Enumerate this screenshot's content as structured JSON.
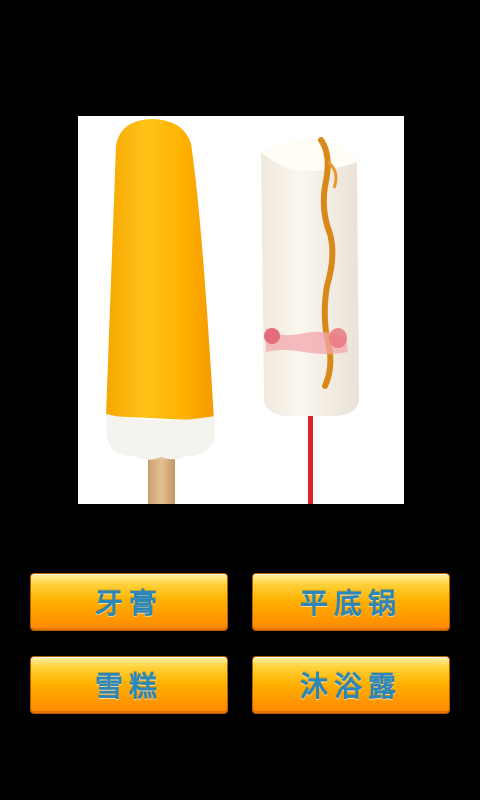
{
  "question": {
    "image": "ice-pops-photo"
  },
  "answers": [
    {
      "label": "牙膏"
    },
    {
      "label": "平底锅"
    },
    {
      "label": "雪糕"
    },
    {
      "label": "沐浴露"
    }
  ],
  "colors": {
    "background": "#000000",
    "button_top": "#ffe27a",
    "button_bottom": "#ff8a00",
    "button_text": "#2c86b6"
  }
}
